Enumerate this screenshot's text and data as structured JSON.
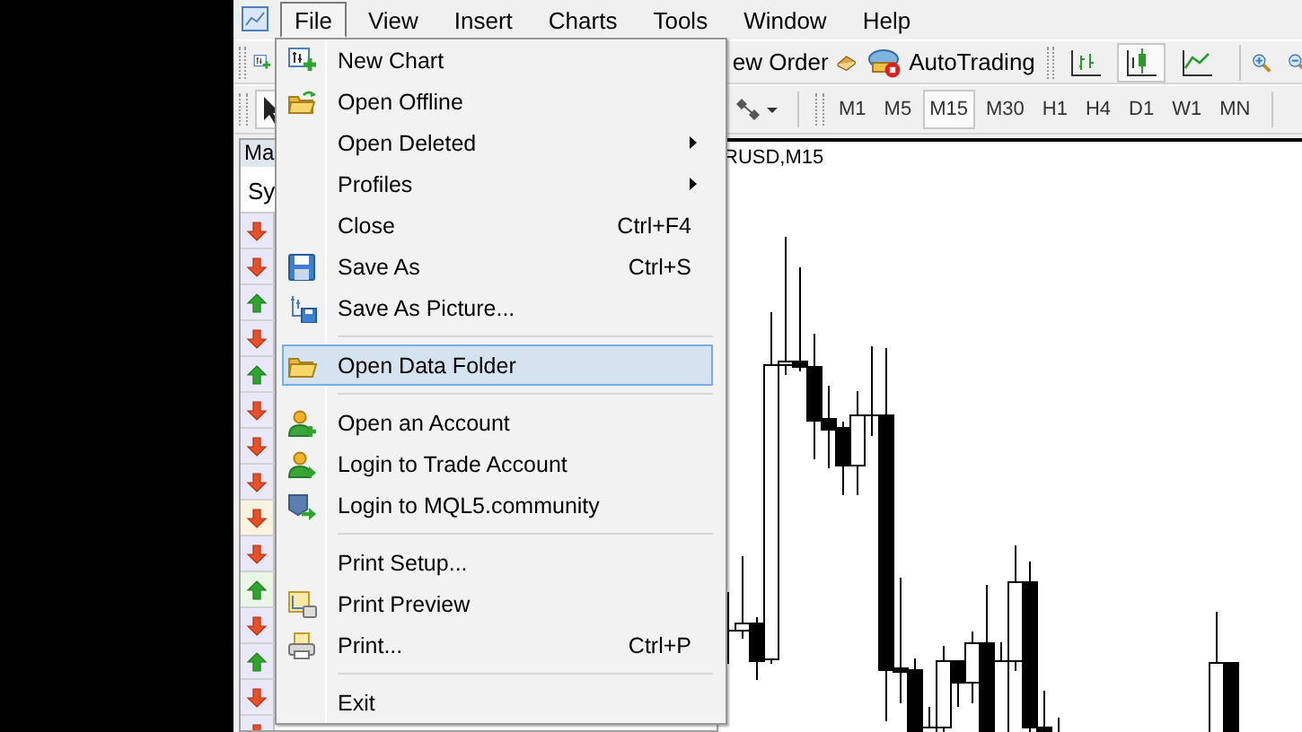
{
  "menu_bar": [
    {
      "label": "File",
      "selected": true
    },
    {
      "label": "View",
      "selected": false
    },
    {
      "label": "Insert",
      "selected": false
    },
    {
      "label": "Charts",
      "selected": false
    },
    {
      "label": "Tools",
      "selected": false
    },
    {
      "label": "Window",
      "selected": false
    },
    {
      "label": "Help",
      "selected": false
    }
  ],
  "toolbar": {
    "new_order_label": "ew Order",
    "autotrading_label": "AutoTrading",
    "chart_types": [
      {
        "selected": false
      },
      {
        "selected": true
      },
      {
        "selected": false
      }
    ]
  },
  "timeframes": [
    {
      "label": "M1",
      "selected": false
    },
    {
      "label": "M5",
      "selected": false
    },
    {
      "label": "M15",
      "selected": true
    },
    {
      "label": "M30",
      "selected": false
    },
    {
      "label": "H1",
      "selected": false
    },
    {
      "label": "H4",
      "selected": false
    },
    {
      "label": "D1",
      "selected": false
    },
    {
      "label": "W1",
      "selected": false
    },
    {
      "label": "MN",
      "selected": false
    }
  ],
  "market_watch": {
    "title": "Ma",
    "column_1": "Sy",
    "rows": [
      {
        "kind": "down",
        "color": "#e8e8f8"
      },
      {
        "kind": "down",
        "color": "#e8e8f8"
      },
      {
        "kind": "up",
        "color": "#e8e8f8"
      },
      {
        "kind": "down",
        "color": "#e8e8f8"
      },
      {
        "kind": "up",
        "color": "#e8e8f8"
      },
      {
        "kind": "down",
        "color": "#e8e8f8"
      },
      {
        "kind": "down",
        "color": "#e8e8f8"
      },
      {
        "kind": "down",
        "color": "#e8e8f8"
      },
      {
        "kind": "down",
        "color": "#fbf3e0"
      },
      {
        "kind": "down",
        "color": "#e8e8f8"
      },
      {
        "kind": "up",
        "color": "#eaf6e6"
      },
      {
        "kind": "down",
        "color": "#e8e8f8"
      },
      {
        "kind": "up",
        "color": "#e8e8f8"
      },
      {
        "kind": "down",
        "color": "#e8e8f8"
      },
      {
        "kind": "down",
        "color": "#e8e8f8"
      }
    ]
  },
  "chart": {
    "title": "RUSD,M15"
  },
  "file_menu": {
    "items": [
      {
        "kind": "item",
        "label": "New Chart",
        "selected": false
      },
      {
        "kind": "item",
        "label": "Open Offline",
        "selected": false
      },
      {
        "kind": "item",
        "label": "Open Deleted",
        "submenu": true,
        "selected": false
      },
      {
        "kind": "item",
        "label": "Profiles",
        "submenu": true,
        "selected": false
      },
      {
        "kind": "item",
        "label": "Close",
        "shortcut": "Ctrl+F4",
        "selected": false
      },
      {
        "kind": "item",
        "label": "Save As",
        "shortcut": "Ctrl+S",
        "selected": false
      },
      {
        "kind": "item",
        "label": "Save As Picture...",
        "selected": false
      },
      {
        "kind": "separator"
      },
      {
        "kind": "item",
        "label": "Open Data Folder",
        "selected": true
      },
      {
        "kind": "separator"
      },
      {
        "kind": "item",
        "label": "Open an Account",
        "selected": false
      },
      {
        "kind": "item",
        "label": "Login to Trade Account",
        "selected": false
      },
      {
        "kind": "item",
        "label": "Login to MQL5.community",
        "selected": false
      },
      {
        "kind": "separator"
      },
      {
        "kind": "item",
        "label": "Print Setup...",
        "selected": false
      },
      {
        "kind": "item",
        "label": "Print Preview",
        "selected": false
      },
      {
        "kind": "item",
        "label": "Print...",
        "shortcut": "Ctrl+P",
        "selected": false
      },
      {
        "kind": "separator"
      },
      {
        "kind": "item",
        "label": "Exit",
        "selected": false
      }
    ]
  }
}
